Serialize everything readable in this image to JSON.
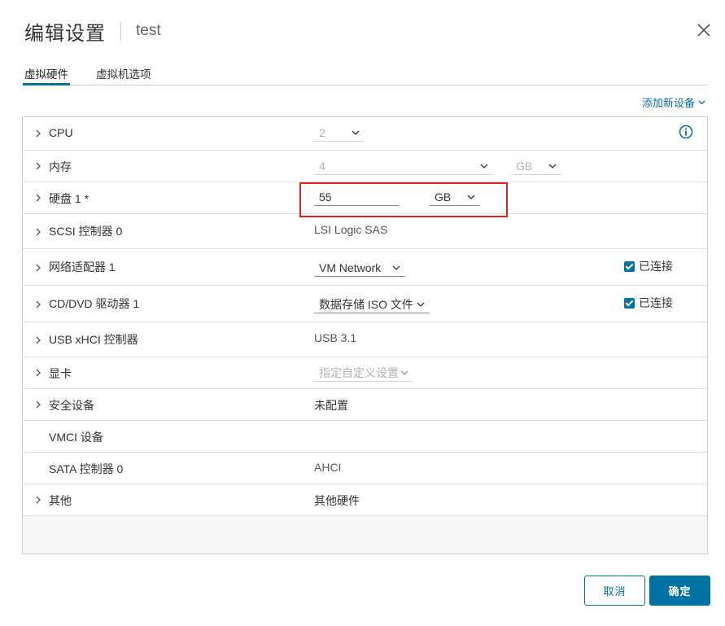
{
  "dialog": {
    "title": "编辑设置",
    "subtitle": "test"
  },
  "tabs": [
    {
      "label": "虚拟硬件",
      "active": true
    },
    {
      "label": "虚拟机选项",
      "active": false
    }
  ],
  "add_device_label": "添加新设备",
  "hardware": {
    "cpu": {
      "label": "CPU",
      "value": "2"
    },
    "memory": {
      "label": "内存",
      "value": "4",
      "unit": "GB"
    },
    "disk": {
      "label": "硬盘 1 *",
      "value": "55",
      "unit": "GB"
    },
    "scsi": {
      "label": "SCSI 控制器 0",
      "value": "LSI Logic SAS"
    },
    "network": {
      "label": "网络适配器 1",
      "value": "VM Network",
      "connected_label": "已连接",
      "connected": true
    },
    "cdrom": {
      "label": "CD/DVD 驱动器 1",
      "value": "数据存储 ISO 文件",
      "connected_label": "已连接",
      "connected": true
    },
    "usb": {
      "label": "USB xHCI 控制器",
      "value": "USB 3.1"
    },
    "video": {
      "label": "显卡",
      "value": "指定自定义设置"
    },
    "security": {
      "label": "安全设备",
      "value": "未配置"
    },
    "vmci": {
      "label": "VMCI 设备"
    },
    "sata": {
      "label": "SATA 控制器 0",
      "value": "AHCI"
    },
    "other": {
      "label": "其他",
      "value": "其他硬件"
    }
  },
  "buttons": {
    "cancel": "取消",
    "ok": "确定"
  },
  "colors": {
    "accent": "#0072a3",
    "highlight": "#e02020"
  }
}
